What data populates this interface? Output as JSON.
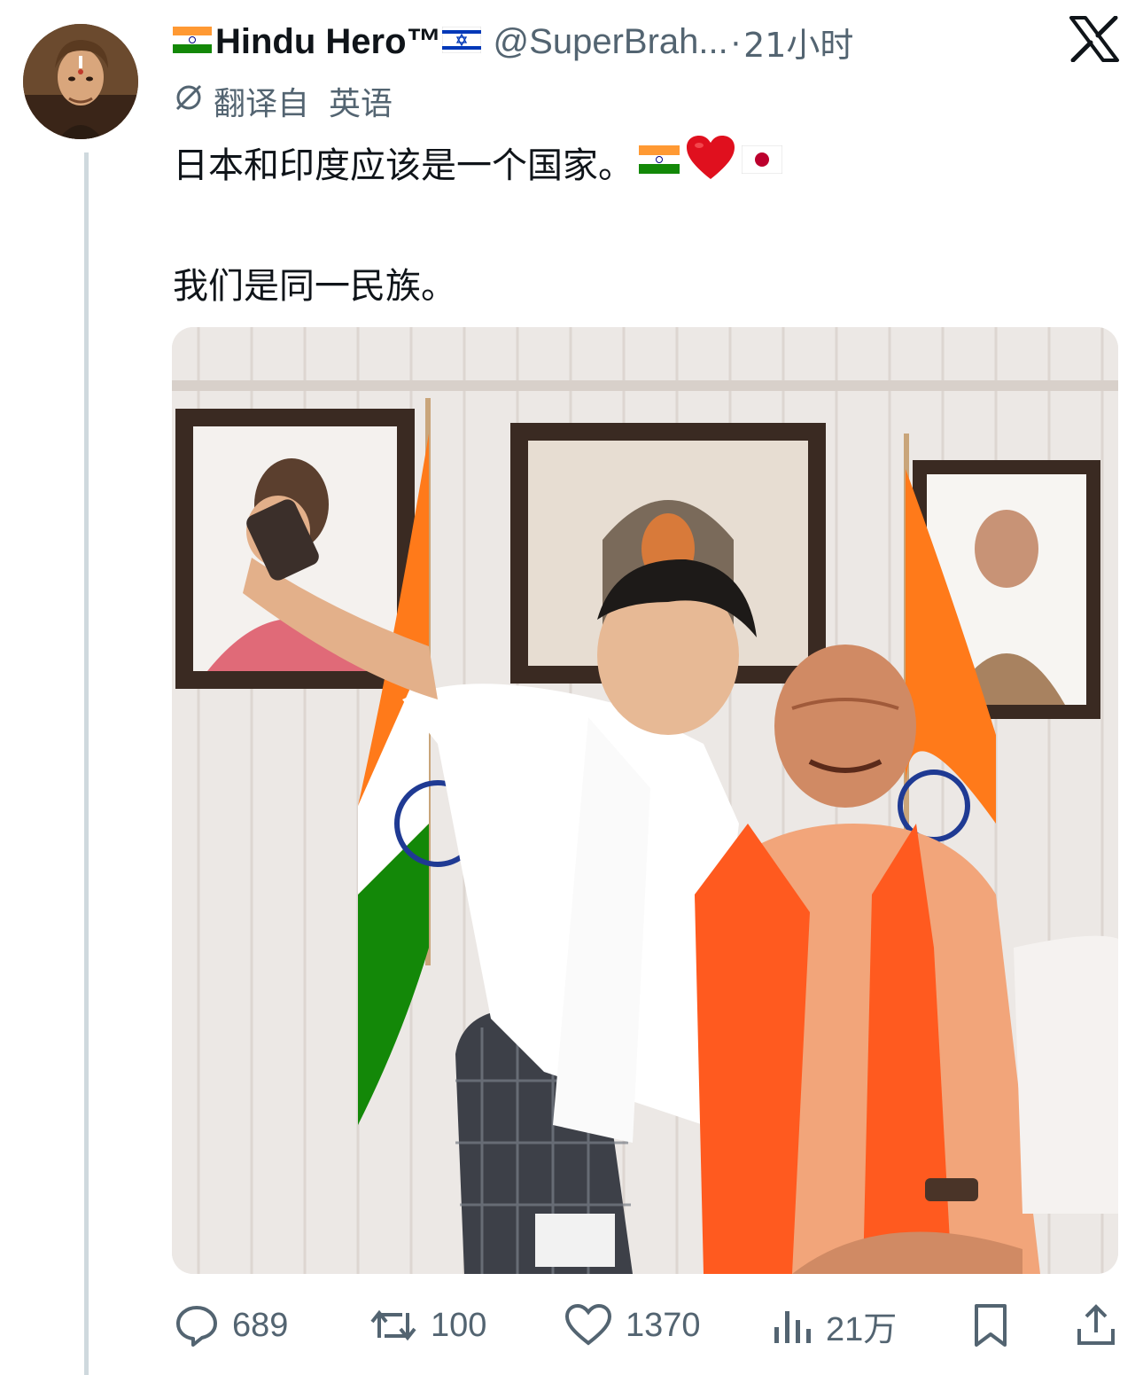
{
  "tweet": {
    "author": {
      "display_name": "Hindu Hero™",
      "handle": "@SuperBrah...",
      "time_sep": "·",
      "time": "21小时"
    },
    "translation": {
      "label": "翻译自",
      "language": "英语"
    },
    "text_line1": "日本和印度应该是一个国家。",
    "text_line2": "我们是同一民族。",
    "emoji": [
      "india-flag",
      "red-heart",
      "japan-flag"
    ],
    "image": {}
  },
  "actions": {
    "replies": "689",
    "retweets": "100",
    "likes": "1370",
    "views": "21万"
  },
  "colors": {
    "text": "#0f1419",
    "secondary": "#536471",
    "thread_line": "#cfd9de",
    "saffron": "#ff7a1a",
    "green": "#138808"
  }
}
